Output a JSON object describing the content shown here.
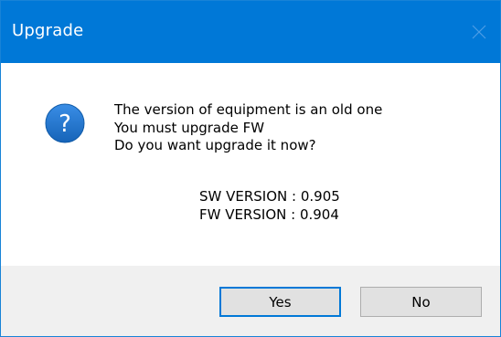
{
  "window": {
    "title": "Upgrade"
  },
  "icons": {
    "dialog_icon": "question-icon",
    "close_icon": "close-icon"
  },
  "message": {
    "lines": [
      "The version of equipment is an old one",
      "You must upgrade FW",
      "Do you want upgrade it now?"
    ]
  },
  "versions": {
    "sw": "SW VERSION : 0.905",
    "fw": "FW VERSION : 0.904"
  },
  "buttons": {
    "yes": "Yes",
    "no": "No"
  },
  "colors": {
    "titlebar": "#0078d7",
    "default_button_border": "#0078d7",
    "footer": "#f0f0f0"
  }
}
